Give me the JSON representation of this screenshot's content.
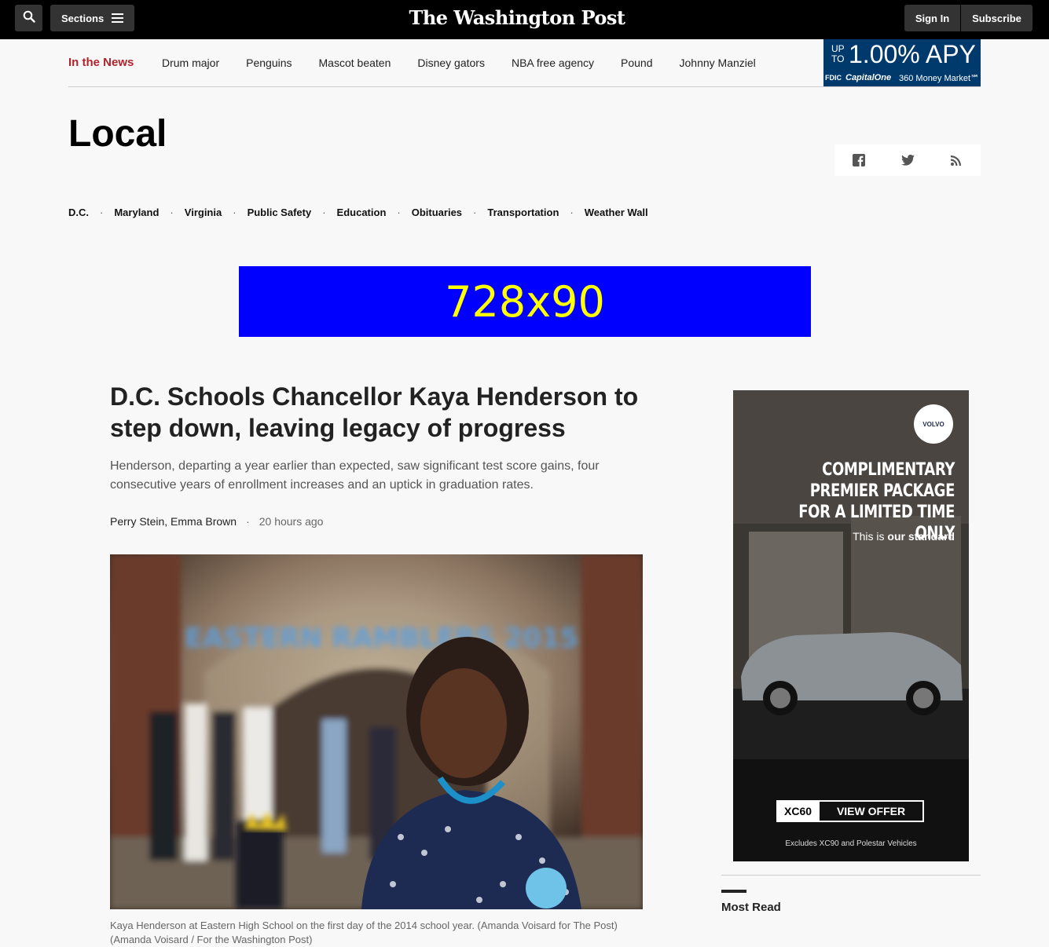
{
  "header": {
    "sections_label": "Sections",
    "logo": "The Washington Post",
    "signin_label": "Sign In",
    "subscribe_label": "Subscribe"
  },
  "in_the_news": {
    "label": "In the News",
    "items": [
      "Drum major",
      "Penguins",
      "Mascot beaten",
      "Disney gators",
      "NBA free agency",
      "Pound",
      "Johnny Manziel"
    ]
  },
  "top_ad": {
    "upto": "UP TO",
    "rate": "1.00% APY",
    "fdic": "FDIC",
    "brand": "CapitalOne",
    "product": "360 Money Market℠"
  },
  "section": {
    "title": "Local",
    "subnav": [
      "D.C.",
      "Maryland",
      "Virginia",
      "Public Safety",
      "Education",
      "Obituaries",
      "Transportation",
      "Weather Wall"
    ]
  },
  "leaderboard_ad": {
    "label": "728x90"
  },
  "article": {
    "headline": "D.C. Schools Chancellor Kaya Henderson to step down, leaving legacy of progress",
    "dek": "Henderson, departing a year earlier than expected, saw significant test score gains, four consecutive years of enrollment increases and an uptick in graduation rates.",
    "authors": "Perry Stein, Emma Brown",
    "time": "20 hours ago",
    "photo_banner": "EASTERN RAMBLERS 2015",
    "caption": "Kaya Henderson at Eastern High School on the first day of the 2014 school year. (Amanda Voisard for The Post) (Amanda Voisard / For the Washington Post)"
  },
  "rail_ad": {
    "brand": "VOLVO",
    "headline_lines": [
      "COMPLIMENTARY",
      "PREMIER PACKAGE",
      "FOR A LIMITED TIME ONLY"
    ],
    "tag_prefix": "This is ",
    "tag_bold": "our standard",
    "model": "XC60",
    "cta": "VIEW OFFER",
    "disclaimer": "Excludes XC90 and Polestar Vehicles"
  },
  "rail": {
    "most_read": "Most Read"
  }
}
